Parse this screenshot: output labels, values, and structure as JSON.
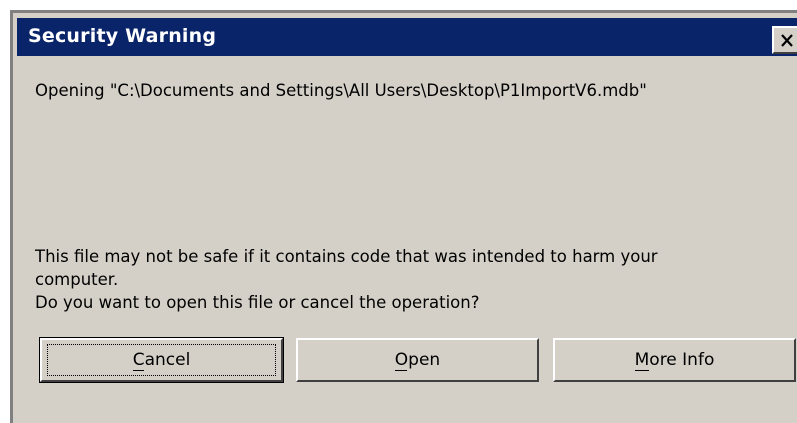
{
  "dialog": {
    "title": "Security Warning",
    "close_glyph": "×",
    "opening_line": "Opening \"C:\\Documents and Settings\\All Users\\Desktop\\P1ImportV6.mdb\"",
    "warning_line_1": "This file may not be safe if it contains code that was intended to harm your",
    "warning_line_2": "computer.",
    "question_line": "Do you want to open this file or cancel the operation?"
  },
  "buttons": {
    "cancel_label": "Cancel",
    "open_label": "Open",
    "more_info_label": "More Info"
  },
  "icons": {
    "close": "close-icon"
  },
  "colors": {
    "titlebar": "#0a246a",
    "face": "#d4d0c8"
  }
}
